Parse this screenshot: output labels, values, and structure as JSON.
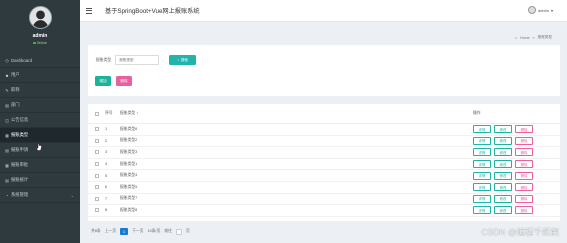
{
  "app": {
    "title": "基于SpringBoot+Vue网上报账系统"
  },
  "profile": {
    "name": "admin",
    "status": "Online"
  },
  "user_menu": {
    "label": "admin"
  },
  "sidebar": {
    "items": [
      {
        "label": "Dashboard",
        "icon": "dashboard-icon"
      },
      {
        "label": "用户",
        "icon": "user-icon"
      },
      {
        "label": "职称",
        "icon": "title-icon"
      },
      {
        "label": "部门",
        "icon": "department-icon"
      },
      {
        "label": "公告信息",
        "icon": "notice-icon"
      },
      {
        "label": "报账类型",
        "icon": "category-icon",
        "active": true
      },
      {
        "label": "报账申请",
        "icon": "apply-icon"
      },
      {
        "label": "报账审批",
        "icon": "approve-icon"
      },
      {
        "label": "报账统计",
        "icon": "stats-icon"
      },
      {
        "label": "系统管理",
        "icon": "settings-icon"
      }
    ]
  },
  "breadcrumb": {
    "home": "Home",
    "current": "报账类型"
  },
  "search": {
    "label": "报账类型",
    "placeholder": "报账类型",
    "button": "搜索"
  },
  "actions": {
    "add": "增加",
    "delete": "删除"
  },
  "table": {
    "headers": {
      "index": "序号",
      "name": "报账类型",
      "ops": "操作"
    },
    "row_actions": {
      "detail": "详情",
      "edit": "修改",
      "delete": "删除"
    },
    "rows": [
      {
        "index": "1",
        "name": "报账类型6"
      },
      {
        "index": "2",
        "name": "报账类型2"
      },
      {
        "index": "3",
        "name": "报账类型3"
      },
      {
        "index": "4",
        "name": "报账类型1"
      },
      {
        "index": "5",
        "name": "报账类型4"
      },
      {
        "index": "6",
        "name": "报账类型5"
      },
      {
        "index": "7",
        "name": "报账类型7"
      },
      {
        "index": "8",
        "name": "报账类型8"
      }
    ]
  },
  "pagination": {
    "total": "共8条",
    "prev": "上一页",
    "current": "1",
    "next": "下一页",
    "page_size": "10条/页",
    "goto": "前往",
    "page_unit": "页"
  },
  "watermark": "CSDN @编程千纸鹤",
  "colors": {
    "sidebar": "#2f3a3f",
    "primary": "#1fb5ad",
    "danger": "#e8609d",
    "page_active": "#1a7bd4"
  }
}
